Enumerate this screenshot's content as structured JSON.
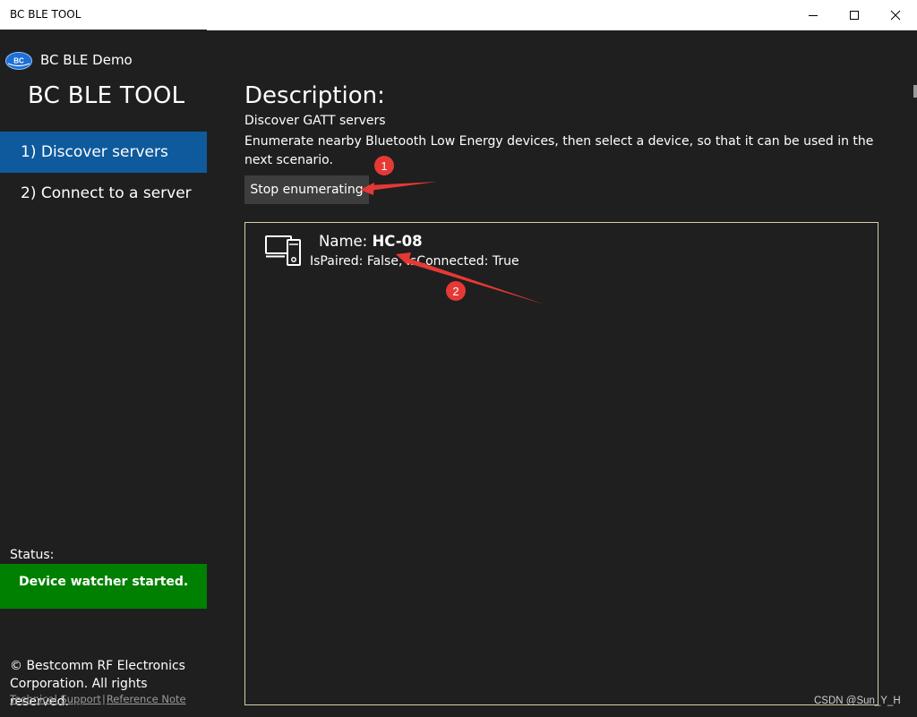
{
  "window": {
    "title": "BC BLE TOOL",
    "controls": {
      "minimize": "minimize-icon",
      "maximize": "maximize-icon",
      "close": "close-icon"
    }
  },
  "sidebar": {
    "app_name": "BC BLE Demo",
    "heading": "BC BLE TOOL",
    "nav": [
      {
        "label": "1) Discover servers",
        "selected": true
      },
      {
        "label": "2) Connect to a server",
        "selected": false
      }
    ],
    "status_label": "Status:",
    "status_text": "Device watcher started.",
    "copyright": "© Bestcomm RF Electronics Corporation. All rights reserved.",
    "links": [
      "Technical Support",
      "Reference Note"
    ],
    "link_separator": "|",
    "logo_text": "BC"
  },
  "main": {
    "description_title": "Description:",
    "description_subtitle": "Discover GATT servers",
    "description_body": "Enumerate nearby Bluetooth Low Energy devices, then select a device, so that it can be used in the next scenario.",
    "stop_button": "Stop enumerating",
    "devices": [
      {
        "name_label": "Name:",
        "name": "HC-08",
        "status": "IsPaired: False, IsConnected: True",
        "icon": "devices-icon"
      }
    ]
  },
  "annotations": {
    "markers": [
      "1",
      "2"
    ]
  },
  "watermark": "CSDN @Sun_Y_H",
  "colors": {
    "accent": "#0e5a9d",
    "status_ok": "#008000",
    "marker": "#e53935",
    "list_border": "#d8cfa8",
    "background": "#1f1f1f"
  }
}
